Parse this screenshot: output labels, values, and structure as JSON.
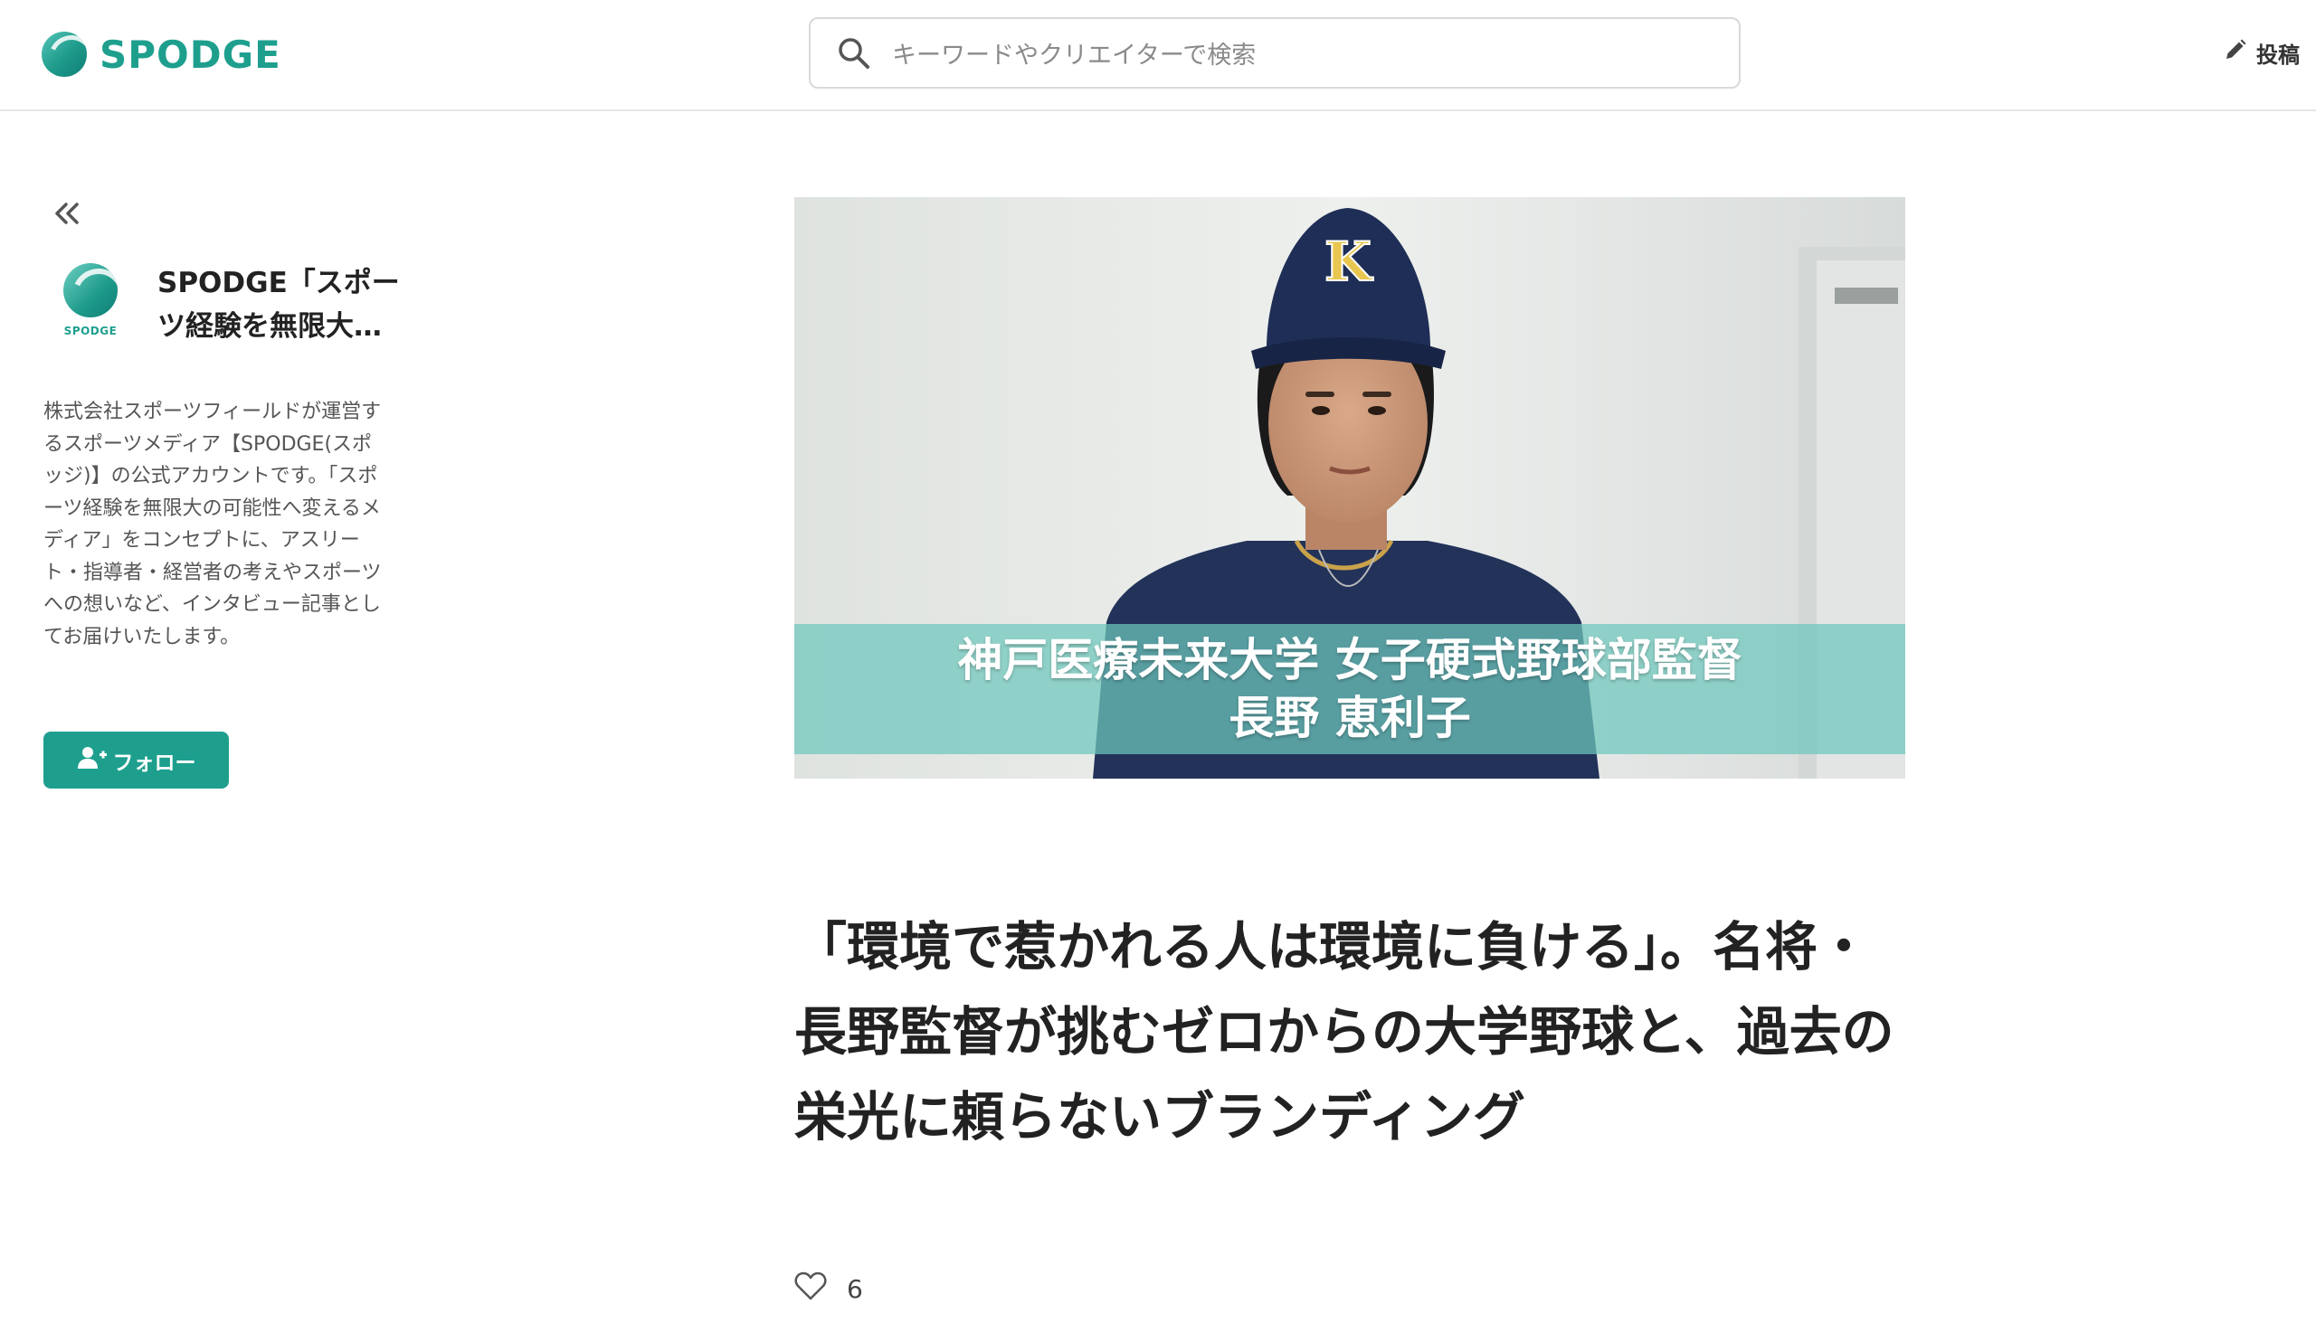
{
  "header": {
    "logo_text": "SPODGE",
    "search_placeholder": "キーワードやクリエイターで検索",
    "post_label": "投稿"
  },
  "sidebar": {
    "account_name": "SPODGE「スポーツ経験を無限大…",
    "avatar_label": "SPODGE",
    "bio": "株式会社スポーツフィールドが運営するスポーツメディア【SPODGE(スポッジ)】の公式アカウントです。「スポーツ経験を無限大の可能性へ変えるメディア」をコンセプトに、アスリート・指導者・経営者の考えやスポーツへの想いなど、インタビュー記事としてお届けいたします。",
    "follow_label": "フォロー"
  },
  "article": {
    "image_caption_line1": "神戸医療未来大学 女子硬式野球部監督",
    "image_caption_line2": "長野 恵利子",
    "cap_letter": "K",
    "title": "「環境で惹かれる人は環境に負ける」。名将・長野監督が挑むゼロからの大学野球と、過去の栄光に頼らないブランディング",
    "like_count": "6"
  },
  "colors": {
    "brand": "#1e9f8e",
    "caption_band": "#6ec8bc"
  }
}
